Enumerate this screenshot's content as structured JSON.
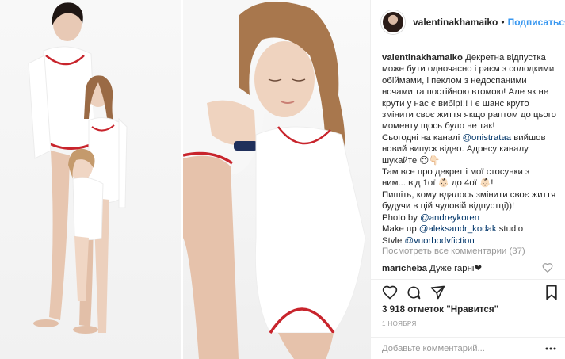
{
  "header": {
    "username": "valentinakhamaiko",
    "separator": "•",
    "follow_label": "Подписаться"
  },
  "caption": {
    "author": "valentinakhamaiko",
    "line1": "Декретна відпустка може бути одночасно і раєм з солодкими обіймами, і пеклом з недоспаними ночами та постійною втомою! Але як не крути у нас є вибір!!! І є шанс круто змінити своє життя якщо раптом до цього моменту щось було не так!",
    "line2_prefix": "Сьогодні на каналі",
    "line2_mention": "@onistrataa",
    "line2_suffix": "вийшов новий випуск відео. Адресу каналу шукайте 😉👇🏻",
    "line3": "Там все про декрет і мої стосунки з ним....від 1ої 👶🏻 до 4ої 👶🏻!",
    "line4": "Пишіть, кому вдалось змінити своє життя будучи в цій чудовій відпустці))!",
    "photo_prefix": "Photo by",
    "photo_mention": "@andreykoren",
    "makeup_prefix": "Make up",
    "makeup_mention": "@aleksandr_kodak",
    "makeup_suffix": "studio",
    "style_prefix": "Style",
    "style_mention": "@yuorbodyfiction"
  },
  "comments": {
    "view_all": "Посмотреть все комментарии (37)",
    "items": [
      {
        "author": "maricheba",
        "text": "Дуже гарні❤"
      }
    ]
  },
  "likes": "3 918 отметок \"Нравится\"",
  "date": "1 НОЯБРЯ",
  "add_comment": {
    "placeholder": "Добавьте комментарий..."
  },
  "colors": {
    "link_blue": "#3897f0",
    "mention": "#003569",
    "muted": "#999999",
    "text": "#262626"
  },
  "icons": [
    "heart-icon",
    "comment-icon",
    "share-icon",
    "bookmark-icon",
    "more-icon"
  ]
}
